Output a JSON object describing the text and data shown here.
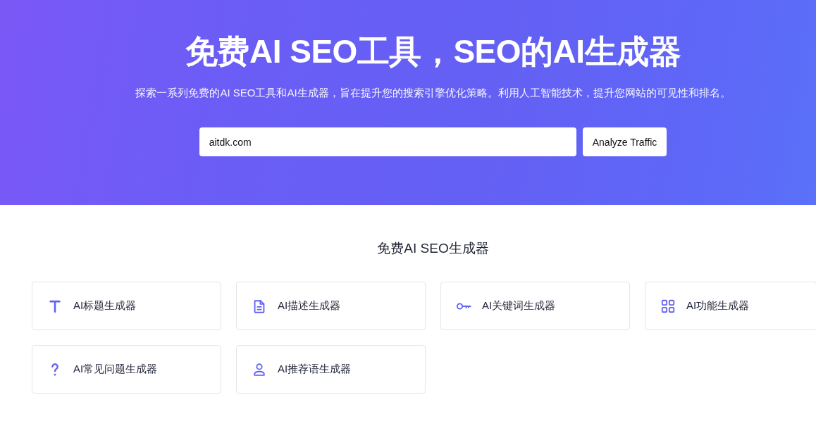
{
  "hero": {
    "title": "免费AI SEO工具，SEO的AI生成器",
    "subtitle": "探索一系列免费的AI SEO工具和AI生成器，旨在提升您的搜索引擎优化策略。利用人工智能技术，提升您网站的可见性和排名。",
    "search": {
      "value": "aitdk.com"
    },
    "button": "Analyze Traffic"
  },
  "section": {
    "title": "免费AI SEO生成器",
    "cards": [
      {
        "label": "AI标题生成器"
      },
      {
        "label": "AI描述生成器"
      },
      {
        "label": "AI关键词生成器"
      },
      {
        "label": "AI功能生成器"
      },
      {
        "label": "AI常见问题生成器"
      },
      {
        "label": "AI推荐语生成器"
      }
    ]
  }
}
